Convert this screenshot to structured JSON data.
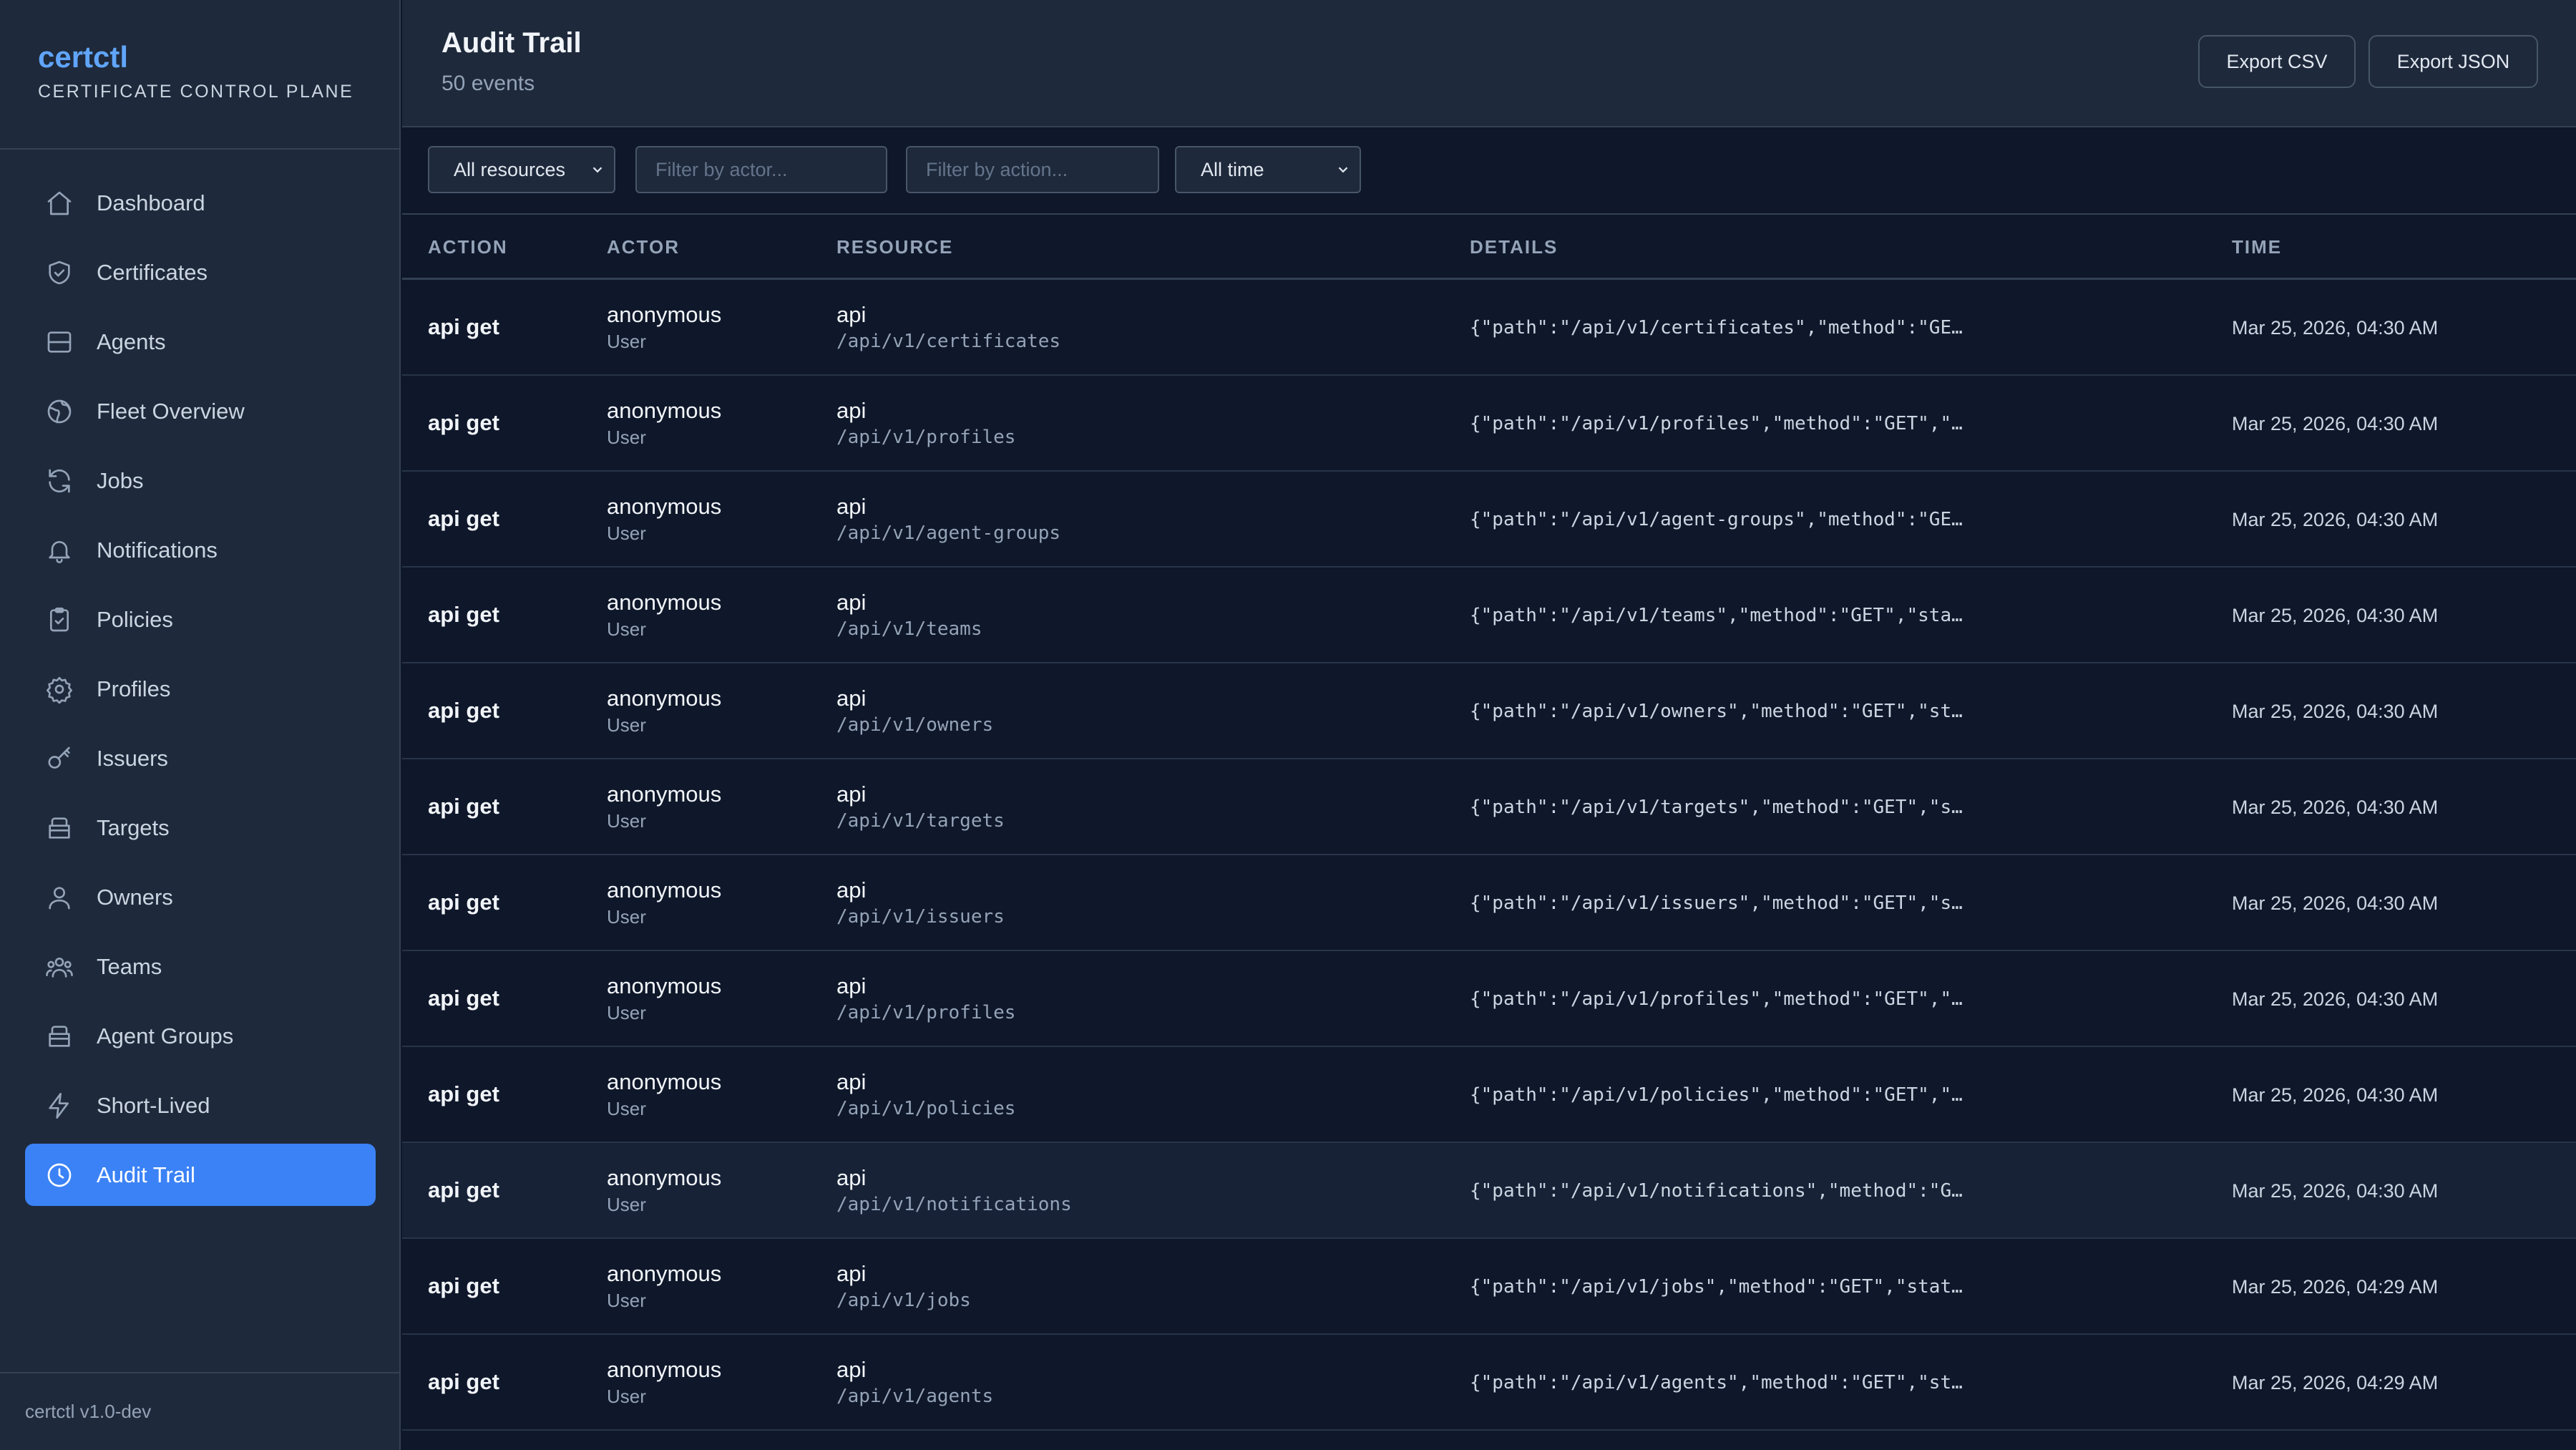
{
  "app": {
    "name": "certctl",
    "subtitle": "CERTIFICATE CONTROL PLANE",
    "version": "certctl v1.0-dev"
  },
  "sidebar": {
    "items": [
      {
        "label": "Dashboard",
        "icon": "home-icon"
      },
      {
        "label": "Certificates",
        "icon": "shield-icon"
      },
      {
        "label": "Agents",
        "icon": "server-icon"
      },
      {
        "label": "Fleet Overview",
        "icon": "globe-icon"
      },
      {
        "label": "Jobs",
        "icon": "refresh-icon"
      },
      {
        "label": "Notifications",
        "icon": "bell-icon"
      },
      {
        "label": "Policies",
        "icon": "clipboard-check-icon"
      },
      {
        "label": "Profiles",
        "icon": "gear-icon"
      },
      {
        "label": "Issuers",
        "icon": "key-icon"
      },
      {
        "label": "Targets",
        "icon": "box-icon"
      },
      {
        "label": "Owners",
        "icon": "user-icon"
      },
      {
        "label": "Teams",
        "icon": "users-icon"
      },
      {
        "label": "Agent Groups",
        "icon": "box-icon"
      },
      {
        "label": "Short-Lived",
        "icon": "bolt-icon"
      },
      {
        "label": "Audit Trail",
        "icon": "clock-icon"
      }
    ],
    "active": "Audit Trail"
  },
  "header": {
    "title": "Audit Trail",
    "count": "50 events",
    "export_csv": "Export CSV",
    "export_json": "Export JSON"
  },
  "filters": {
    "resource": "All resources",
    "actor_placeholder": "Filter by actor...",
    "action_placeholder": "Filter by action...",
    "time": "All time"
  },
  "table": {
    "columns": [
      "ACTION",
      "ACTOR",
      "RESOURCE",
      "DETAILS",
      "TIME"
    ],
    "rows": [
      {
        "action": "api get",
        "actor": "anonymous",
        "actor_type": "User",
        "resource": "api",
        "path": "/api/v1/certificates",
        "details": "{\"path\":\"/api/v1/certificates\",\"method\":\"GE…",
        "time": "Mar 25, 2026, 04:30 AM"
      },
      {
        "action": "api get",
        "actor": "anonymous",
        "actor_type": "User",
        "resource": "api",
        "path": "/api/v1/profiles",
        "details": "{\"path\":\"/api/v1/profiles\",\"method\":\"GET\",\"…",
        "time": "Mar 25, 2026, 04:30 AM"
      },
      {
        "action": "api get",
        "actor": "anonymous",
        "actor_type": "User",
        "resource": "api",
        "path": "/api/v1/agent-groups",
        "details": "{\"path\":\"/api/v1/agent-groups\",\"method\":\"GE…",
        "time": "Mar 25, 2026, 04:30 AM"
      },
      {
        "action": "api get",
        "actor": "anonymous",
        "actor_type": "User",
        "resource": "api",
        "path": "/api/v1/teams",
        "details": "{\"path\":\"/api/v1/teams\",\"method\":\"GET\",\"sta…",
        "time": "Mar 25, 2026, 04:30 AM"
      },
      {
        "action": "api get",
        "actor": "anonymous",
        "actor_type": "User",
        "resource": "api",
        "path": "/api/v1/owners",
        "details": "{\"path\":\"/api/v1/owners\",\"method\":\"GET\",\"st…",
        "time": "Mar 25, 2026, 04:30 AM"
      },
      {
        "action": "api get",
        "actor": "anonymous",
        "actor_type": "User",
        "resource": "api",
        "path": "/api/v1/targets",
        "details": "{\"path\":\"/api/v1/targets\",\"method\":\"GET\",\"s…",
        "time": "Mar 25, 2026, 04:30 AM"
      },
      {
        "action": "api get",
        "actor": "anonymous",
        "actor_type": "User",
        "resource": "api",
        "path": "/api/v1/issuers",
        "details": "{\"path\":\"/api/v1/issuers\",\"method\":\"GET\",\"s…",
        "time": "Mar 25, 2026, 04:30 AM"
      },
      {
        "action": "api get",
        "actor": "anonymous",
        "actor_type": "User",
        "resource": "api",
        "path": "/api/v1/profiles",
        "details": "{\"path\":\"/api/v1/profiles\",\"method\":\"GET\",\"…",
        "time": "Mar 25, 2026, 04:30 AM"
      },
      {
        "action": "api get",
        "actor": "anonymous",
        "actor_type": "User",
        "resource": "api",
        "path": "/api/v1/policies",
        "details": "{\"path\":\"/api/v1/policies\",\"method\":\"GET\",\"…",
        "time": "Mar 25, 2026, 04:30 AM"
      },
      {
        "action": "api get",
        "actor": "anonymous",
        "actor_type": "User",
        "resource": "api",
        "path": "/api/v1/notifications",
        "details": "{\"path\":\"/api/v1/notifications\",\"method\":\"G…",
        "time": "Mar 25, 2026, 04:30 AM"
      },
      {
        "action": "api get",
        "actor": "anonymous",
        "actor_type": "User",
        "resource": "api",
        "path": "/api/v1/jobs",
        "details": "{\"path\":\"/api/v1/jobs\",\"method\":\"GET\",\"stat…",
        "time": "Mar 25, 2026, 04:29 AM"
      },
      {
        "action": "api get",
        "actor": "anonymous",
        "actor_type": "User",
        "resource": "api",
        "path": "/api/v1/agents",
        "details": "{\"path\":\"/api/v1/agents\",\"method\":\"GET\",\"st…",
        "time": "Mar 25, 2026, 04:29 AM"
      }
    ]
  },
  "colors": {
    "background": "#0f172a",
    "surface": "#1e293b",
    "accent": "#3b82f6",
    "brand": "#60a5fa"
  }
}
